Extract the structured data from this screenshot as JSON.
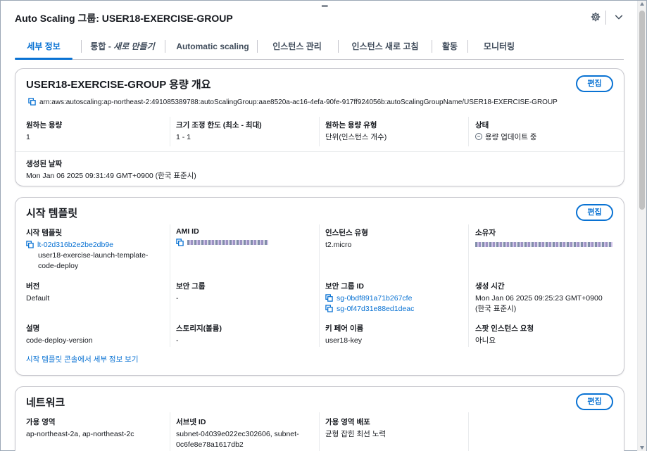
{
  "header": {
    "title": "Auto Scaling 그룹: USER18-EXERCISE-GROUP"
  },
  "tabs": [
    {
      "label": "세부 정보",
      "active": true
    },
    {
      "label_prefix": "통합 - ",
      "label_italic": "새로 만들기"
    },
    {
      "label": "Automatic scaling"
    },
    {
      "label": "인스턴스 관리"
    },
    {
      "label": "인스턴스 새로 고침"
    },
    {
      "label": "활동"
    },
    {
      "label": "모니터링"
    }
  ],
  "capacity": {
    "title": "USER18-EXERCISE-GROUP 용량 개요",
    "edit_label": "편집",
    "arn": "arn:aws:autoscaling:ap-northeast-2:491085389788:autoScalingGroup:aae8520a-ac16-4efa-90fe-917ff924056b:autoScalingGroupName/USER18-EXERCISE-GROUP",
    "desired_label": "원하는 용량",
    "desired_value": "1",
    "limits_label": "크기 조정 한도 (최소 - 최대)",
    "limits_value": "1 - 1",
    "desired_type_label": "원하는 용량 유형",
    "desired_type_value": "단위(인스턴스 개수)",
    "status_label": "상태",
    "status_value": "용량 업데이트 중",
    "created_label": "생성된 날짜",
    "created_value": "Mon Jan 06 2025 09:31:49 GMT+0900 (한국 표준시)"
  },
  "launch_template": {
    "title": "시작 템플릿",
    "edit_label": "편집",
    "template_label": "시작 템플릿",
    "template_id": "lt-02d316b2e2be2db9e",
    "template_name_1": "user18-exercise-launch-template-",
    "template_name_2": "code-deploy",
    "ami_label": "AMI ID",
    "instance_type_label": "인스턴스 유형",
    "instance_type_value": "t2.micro",
    "owner_label": "소유자",
    "version_label": "버전",
    "version_value": "Default",
    "sg_label": "보안 그룹",
    "sg_value": "-",
    "sg_id_label": "보안 그룹 ID",
    "sg_id_1": "sg-0bdf891a71b267cfe",
    "sg_id_2": "sg-0f47d31e88ed1deac",
    "created_time_label": "생성 시간",
    "created_time_1": "Mon Jan 06 2025 09:25:23 GMT+0900",
    "created_time_2": "(한국 표준시)",
    "desc_label": "설명",
    "desc_value": "code-deploy-version",
    "storage_label": "스토리지(볼륨)",
    "storage_value": "-",
    "keypair_label": "키 페어 이름",
    "keypair_value": "user18-key",
    "spot_label": "스팟 인스턴스 요청",
    "spot_value": "아니요",
    "console_link": "시작 템플릿 콘솔에서 세부 정보 보기"
  },
  "network": {
    "title": "네트워크",
    "edit_label": "편집",
    "az_label": "가용 영역",
    "az_value": "ap-northeast-2a, ap-northeast-2c",
    "subnet_label": "서브넷 ID",
    "subnet_value_1": "subnet-04039e022ec302606, subnet-",
    "subnet_value_2": "0c6fe8e78a1617db2",
    "az_dist_label": "가용 영역 배포",
    "az_dist_value": "균형 잡힌 최선 노력"
  },
  "colors": {
    "link": "#0972d3",
    "text": "#16191f",
    "border": "#c6c6cd"
  },
  "icons": [
    "settings-gear-icon",
    "chevron-down-icon",
    "copy-icon",
    "status-in-progress-icon",
    "drag-handle-icon"
  ]
}
